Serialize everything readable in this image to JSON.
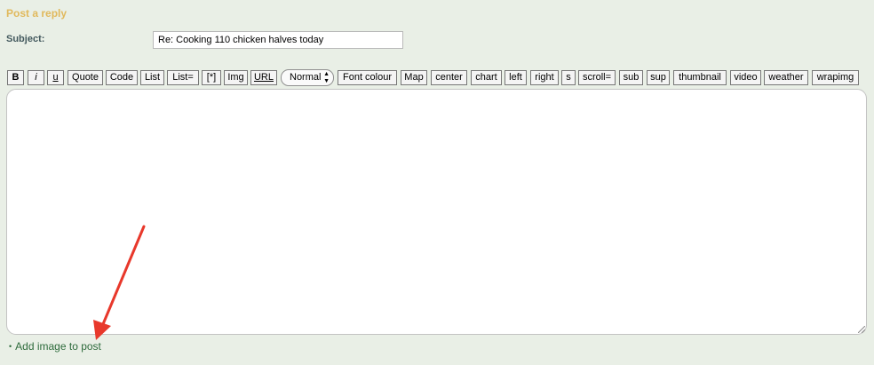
{
  "form": {
    "heading": "Post a reply",
    "subject_label": "Subject:",
    "subject_value": "Re: Cooking 110 chicken halves today"
  },
  "toolbar": {
    "buttons": [
      {
        "id": "b",
        "label": "B"
      },
      {
        "id": "i",
        "label": "i"
      },
      {
        "id": "u",
        "label": "u"
      },
      {
        "id": "quote",
        "label": "Quote"
      },
      {
        "id": "code",
        "label": "Code"
      },
      {
        "id": "list",
        "label": "List"
      },
      {
        "id": "list-eq",
        "label": "List="
      },
      {
        "id": "list-item",
        "label": "[*]"
      },
      {
        "id": "img",
        "label": "Img"
      },
      {
        "id": "url",
        "label": "URL"
      },
      {
        "id": "font-colour",
        "label": "Font colour"
      },
      {
        "id": "map",
        "label": "Map"
      },
      {
        "id": "center",
        "label": "center"
      },
      {
        "id": "chart",
        "label": "chart"
      },
      {
        "id": "left",
        "label": "left"
      },
      {
        "id": "right",
        "label": "right"
      },
      {
        "id": "s",
        "label": "s"
      },
      {
        "id": "scroll",
        "label": "scroll="
      },
      {
        "id": "sub",
        "label": "sub"
      },
      {
        "id": "sup",
        "label": "sup"
      },
      {
        "id": "thumbnail",
        "label": "thumbnail"
      },
      {
        "id": "video",
        "label": "video"
      },
      {
        "id": "weather",
        "label": "weather"
      },
      {
        "id": "wrapimg",
        "label": "wrapimg"
      }
    ],
    "font_size_select": {
      "selected": "Normal"
    }
  },
  "editor": {
    "value": ""
  },
  "links": {
    "add_image": "Add image to post"
  },
  "colors": {
    "background": "#e9efe6",
    "heading": "#e1b95c",
    "label": "#43595e",
    "link": "#2e6b3c",
    "annotation_arrow": "#e8382b"
  }
}
